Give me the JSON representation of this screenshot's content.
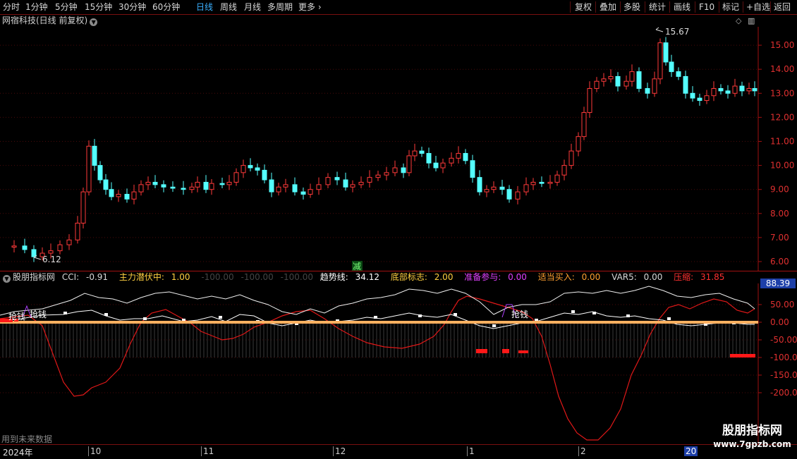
{
  "toolbar": {
    "periods": [
      "分时",
      "1分钟",
      "5分钟",
      "15分钟",
      "30分钟",
      "60分钟",
      "日线",
      "周线",
      "月线",
      "多周期",
      "更多"
    ],
    "active_period": "日线",
    "right_buttons": [
      "复权",
      "叠加",
      "多股",
      "统计",
      "画线",
      "F10",
      "标记",
      "+自选",
      "返回"
    ]
  },
  "main_title": "网宿科技(日线 前复权)",
  "price_axis": [
    "15.00",
    "14.00",
    "13.00",
    "12.00",
    "11.00",
    "10.00",
    "9.00",
    "8.00",
    "7.00",
    "6.00"
  ],
  "price_annotations": {
    "high": "15.67",
    "low": "6.12"
  },
  "signal_main": "减",
  "indicator": {
    "name": "股朋指标网",
    "cci_label": "CCI:",
    "cci_value": "-0.91",
    "zhuli_label": "主力潜伏中:",
    "zhuli_value": "1.00",
    "faint_values": [
      "-100.00",
      "-100.00",
      "-100.00"
    ],
    "trend_label": "趋势线:",
    "trend_value": "34.12",
    "bottom_label": "底部标志:",
    "bottom_value": "2.00",
    "ready_label": "准备参与:",
    "ready_value": "0.00",
    "buy_label": "适当买入:",
    "buy_value": "0.00",
    "var5_label": "VAR5:",
    "var5_value": "0.00",
    "press_label": "压缩:",
    "press_value": "31.85",
    "axis": [
      "50.00",
      "0.00",
      "-50.00",
      "-100.0",
      "-150.0",
      "-200.0"
    ],
    "highlight_value": "88.39",
    "signal_text": "抢钱"
  },
  "bottom": {
    "future_label": "用到未来数据",
    "dates": [
      "2024年",
      "10",
      "11",
      "12",
      "1",
      "2",
      "20"
    ]
  },
  "watermark": {
    "line1": "股朋指标网",
    "line2": "www.7gpzb.com"
  },
  "colors": {
    "up": "#ff3a3a",
    "down": "#54ffff",
    "trend": "#ffffff",
    "red_line": "#e01818",
    "base": "#ffb060"
  }
}
